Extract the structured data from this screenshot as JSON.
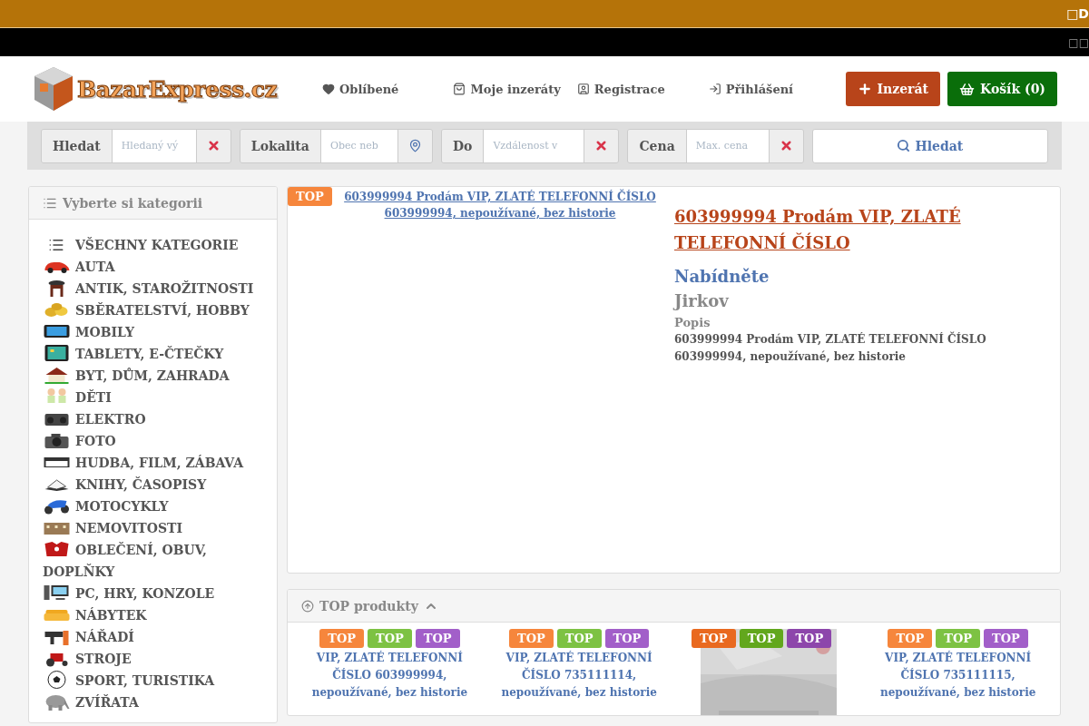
{
  "top_bar": {
    "text": "□D"
  },
  "black_bar": {
    "text": "□□"
  },
  "header": {
    "logo": "BazarExpress.cz",
    "nav": [
      {
        "label": "Oblíbené",
        "kind": "heart"
      },
      {
        "label": "Moje inzeráty",
        "kind": "bag"
      },
      {
        "label": "Registrace",
        "kind": "contact"
      },
      {
        "label": "Přihlášení",
        "kind": "login"
      }
    ],
    "buttons": [
      {
        "label": "Inzerát",
        "kind": "add"
      },
      {
        "label": "Košík (0)",
        "kind": "cart"
      }
    ]
  },
  "search": {
    "groups": [
      {
        "label": "Hledat",
        "placeholder": "Hledaný vý",
        "kind": "clear"
      },
      {
        "label": "Lokalita",
        "placeholder": "Obec neb",
        "kind": "pin"
      },
      {
        "label": "Do",
        "placeholder": "Vzdálenost v",
        "kind": "clear"
      },
      {
        "label": "Cena",
        "placeholder": "Max. cena",
        "kind": "clear"
      }
    ],
    "button": "Hledat"
  },
  "sidebar": {
    "title": "Vyberte si kategorii",
    "categories": [
      {
        "label": "VŠECHNY KATEGORIE"
      },
      {
        "label": "AUTA"
      },
      {
        "label": "ANTIK, STAROŽITNOSTI"
      },
      {
        "label": "SBĚRATELSTVÍ, HOBBY"
      },
      {
        "label": "MOBILY"
      },
      {
        "label": "TABLETY, E-ČTEČKY"
      },
      {
        "label": "BYT, DŮM, ZAHRADA"
      },
      {
        "label": "DĚTI"
      },
      {
        "label": "ELEKTRO"
      },
      {
        "label": "FOTO"
      },
      {
        "label": "HUDBA, FILM, ZÁBAVA"
      },
      {
        "label": "KNIHY, ČASOPISY"
      },
      {
        "label": "MOTOCYKLY"
      },
      {
        "label": "NEMOVITOSTI"
      },
      {
        "label": "OBLEČENÍ, OBUV, DOPLŇKY"
      },
      {
        "label": "PC, HRY, KONZOLE"
      },
      {
        "label": "NÁBYTEK"
      },
      {
        "label": "NÁŘADÍ"
      },
      {
        "label": "STROJE"
      },
      {
        "label": "SPORT, TURISTIKA"
      },
      {
        "label": "ZVÍŘATA"
      }
    ]
  },
  "featured": {
    "badge": "TOP",
    "image_link": "603999994 Prodám VIP, ZLATÉ TELEFONNÍ ČÍSLO 603999994, nepoužívané, bez historie",
    "title": "603999994 Prodám VIP, ZLATÉ TELEFONNÍ ČÍSLO",
    "price": "Nabídněte",
    "location": "Jirkov",
    "description_label": "Popis",
    "description": "603999994 Prodám VIP, ZLATÉ TELEFONNÍ ČÍSLO 603999994, nepoužívané, bez historie"
  },
  "top_products": {
    "title": "TOP produkty",
    "expanded": true,
    "items": [
      {
        "kind": "text",
        "text": "VIP, ZLATÉ TELEFONNÍ ČÍSLO 603999994, nepoužívané, bez historie",
        "badges": [
          {
            "label": "TOP",
            "color": "#f6863c"
          },
          {
            "label": "TOP",
            "color": "#7dc243"
          },
          {
            "label": "TOP",
            "color": "#a25fc9"
          }
        ]
      },
      {
        "kind": "text",
        "text": "VIP, ZLATÉ TELEFONNÍ ČÍSLO 735111114, nepoužívané, bez historie",
        "badges": [
          {
            "label": "TOP",
            "color": "#f6863c"
          },
          {
            "label": "TOP",
            "color": "#7dc243"
          },
          {
            "label": "TOP",
            "color": "#a25fc9"
          }
        ]
      },
      {
        "kind": "picture",
        "badges": [
          {
            "label": "TOP",
            "color": "#e9691f"
          },
          {
            "label": "TOP",
            "color": "#62a71d"
          },
          {
            "label": "TOP",
            "color": "#8d46ab"
          }
        ]
      },
      {
        "kind": "text",
        "text": "VIP, ZLATÉ TELEFONNÍ ČÍSLO 735111115, nepoužívané, bez historie",
        "badges": [
          {
            "label": "TOP",
            "color": "#f6863c"
          },
          {
            "label": "TOP",
            "color": "#7dc243"
          },
          {
            "label": "TOP",
            "color": "#a25fc9"
          }
        ]
      }
    ]
  }
}
